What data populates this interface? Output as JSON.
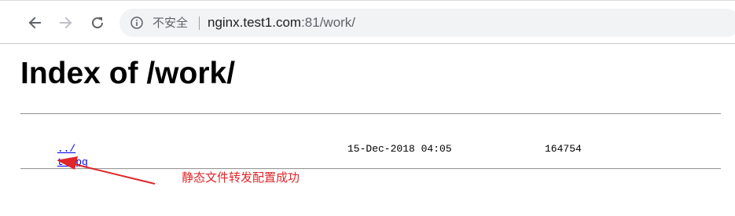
{
  "browser": {
    "security_label": "不安全",
    "url_host": "nginx.test1.com",
    "url_rest": ":81/work/",
    "icons": {
      "back": "arrow-left-icon",
      "forward": "arrow-right-icon",
      "reload": "reload-icon",
      "info": "info-icon"
    }
  },
  "page": {
    "title": "Index of /work/",
    "entries": [
      {
        "name": "../",
        "date": "",
        "size": ""
      },
      {
        "name": "t.jpg",
        "date": "15-Dec-2018 04:05",
        "size": "164754"
      }
    ]
  },
  "annotation": {
    "text": "静态文件转发配置成功",
    "color": "#e0262a"
  }
}
